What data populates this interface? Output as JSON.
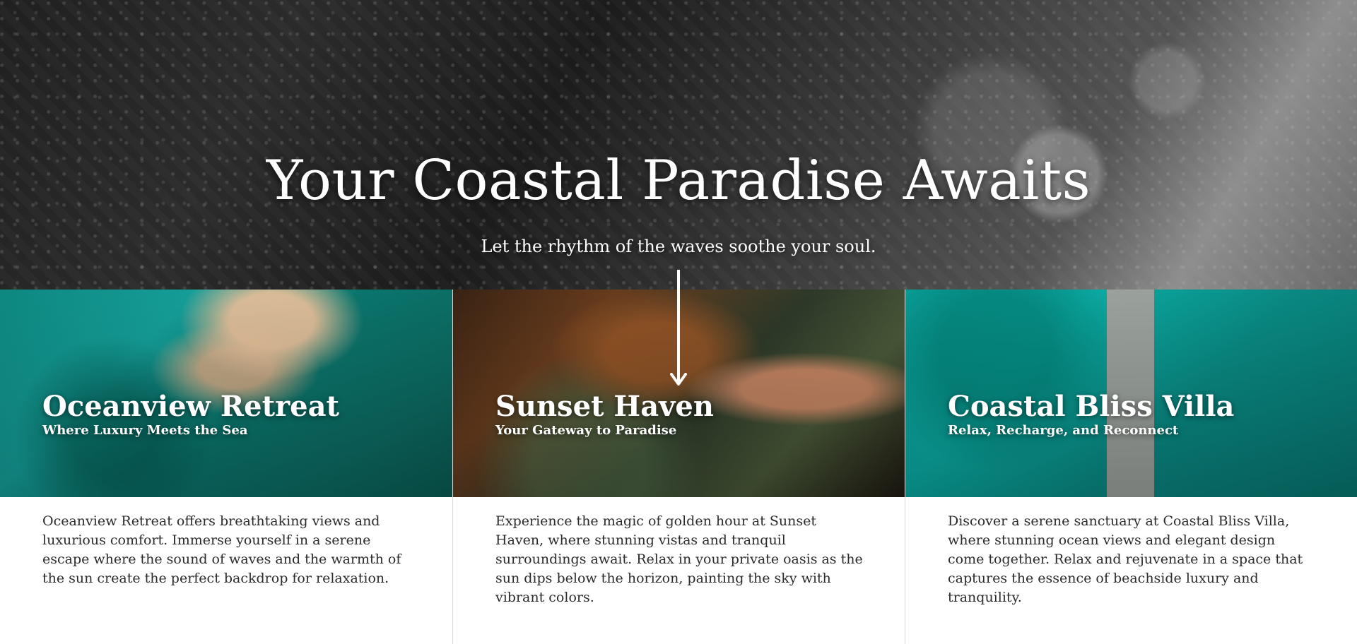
{
  "hero": {
    "title": "Your Coastal Paradise Awaits",
    "subtitle": "Let the rhythm of the waves soothe your soul."
  },
  "cards": [
    {
      "title": "Oceanview Retreat",
      "subtitle": "Where Luxury Meets the Sea",
      "description": "Oceanview Retreat offers breathtaking views and luxurious comfort. Immerse yourself in a serene escape where the sound of waves and the warmth of the sun create the perfect backdrop for relaxation."
    },
    {
      "title": "Sunset Haven",
      "subtitle": "Your Gateway to Paradise",
      "description": "Experience the magic of golden hour at Sunset Haven, where stunning vistas and tranquil surroundings await. Relax in your private oasis as the sun dips below the horizon, painting the sky with vibrant colors."
    },
    {
      "title": "Coastal Bliss Villa",
      "subtitle": "Relax, Recharge, and Reconnect",
      "description": "Discover a serene sanctuary at Coastal Bliss Villa, where stunning ocean views and elegant design come together. Relax and rejuvenate in a space that captures the essence of beachside luxury and tranquility."
    }
  ],
  "icons": {
    "scroll": "arrow-down-icon"
  },
  "colors": {
    "text_light": "#ffffff",
    "text_dark": "#2b2b2b",
    "divider": "#d9d9d9"
  }
}
